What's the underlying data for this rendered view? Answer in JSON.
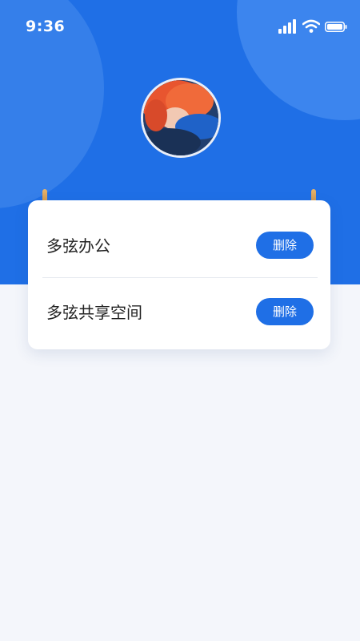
{
  "status_bar": {
    "time": "9:36"
  },
  "profile": {
    "avatar": "user-avatar-photo"
  },
  "list": {
    "items": [
      {
        "name": "多弦办公",
        "action_label": "删除"
      },
      {
        "name": "多弦共享空间",
        "action_label": "删除"
      }
    ]
  },
  "colors": {
    "primary": "#1f6fe6",
    "background": "#f4f6fb",
    "card": "#ffffff"
  }
}
